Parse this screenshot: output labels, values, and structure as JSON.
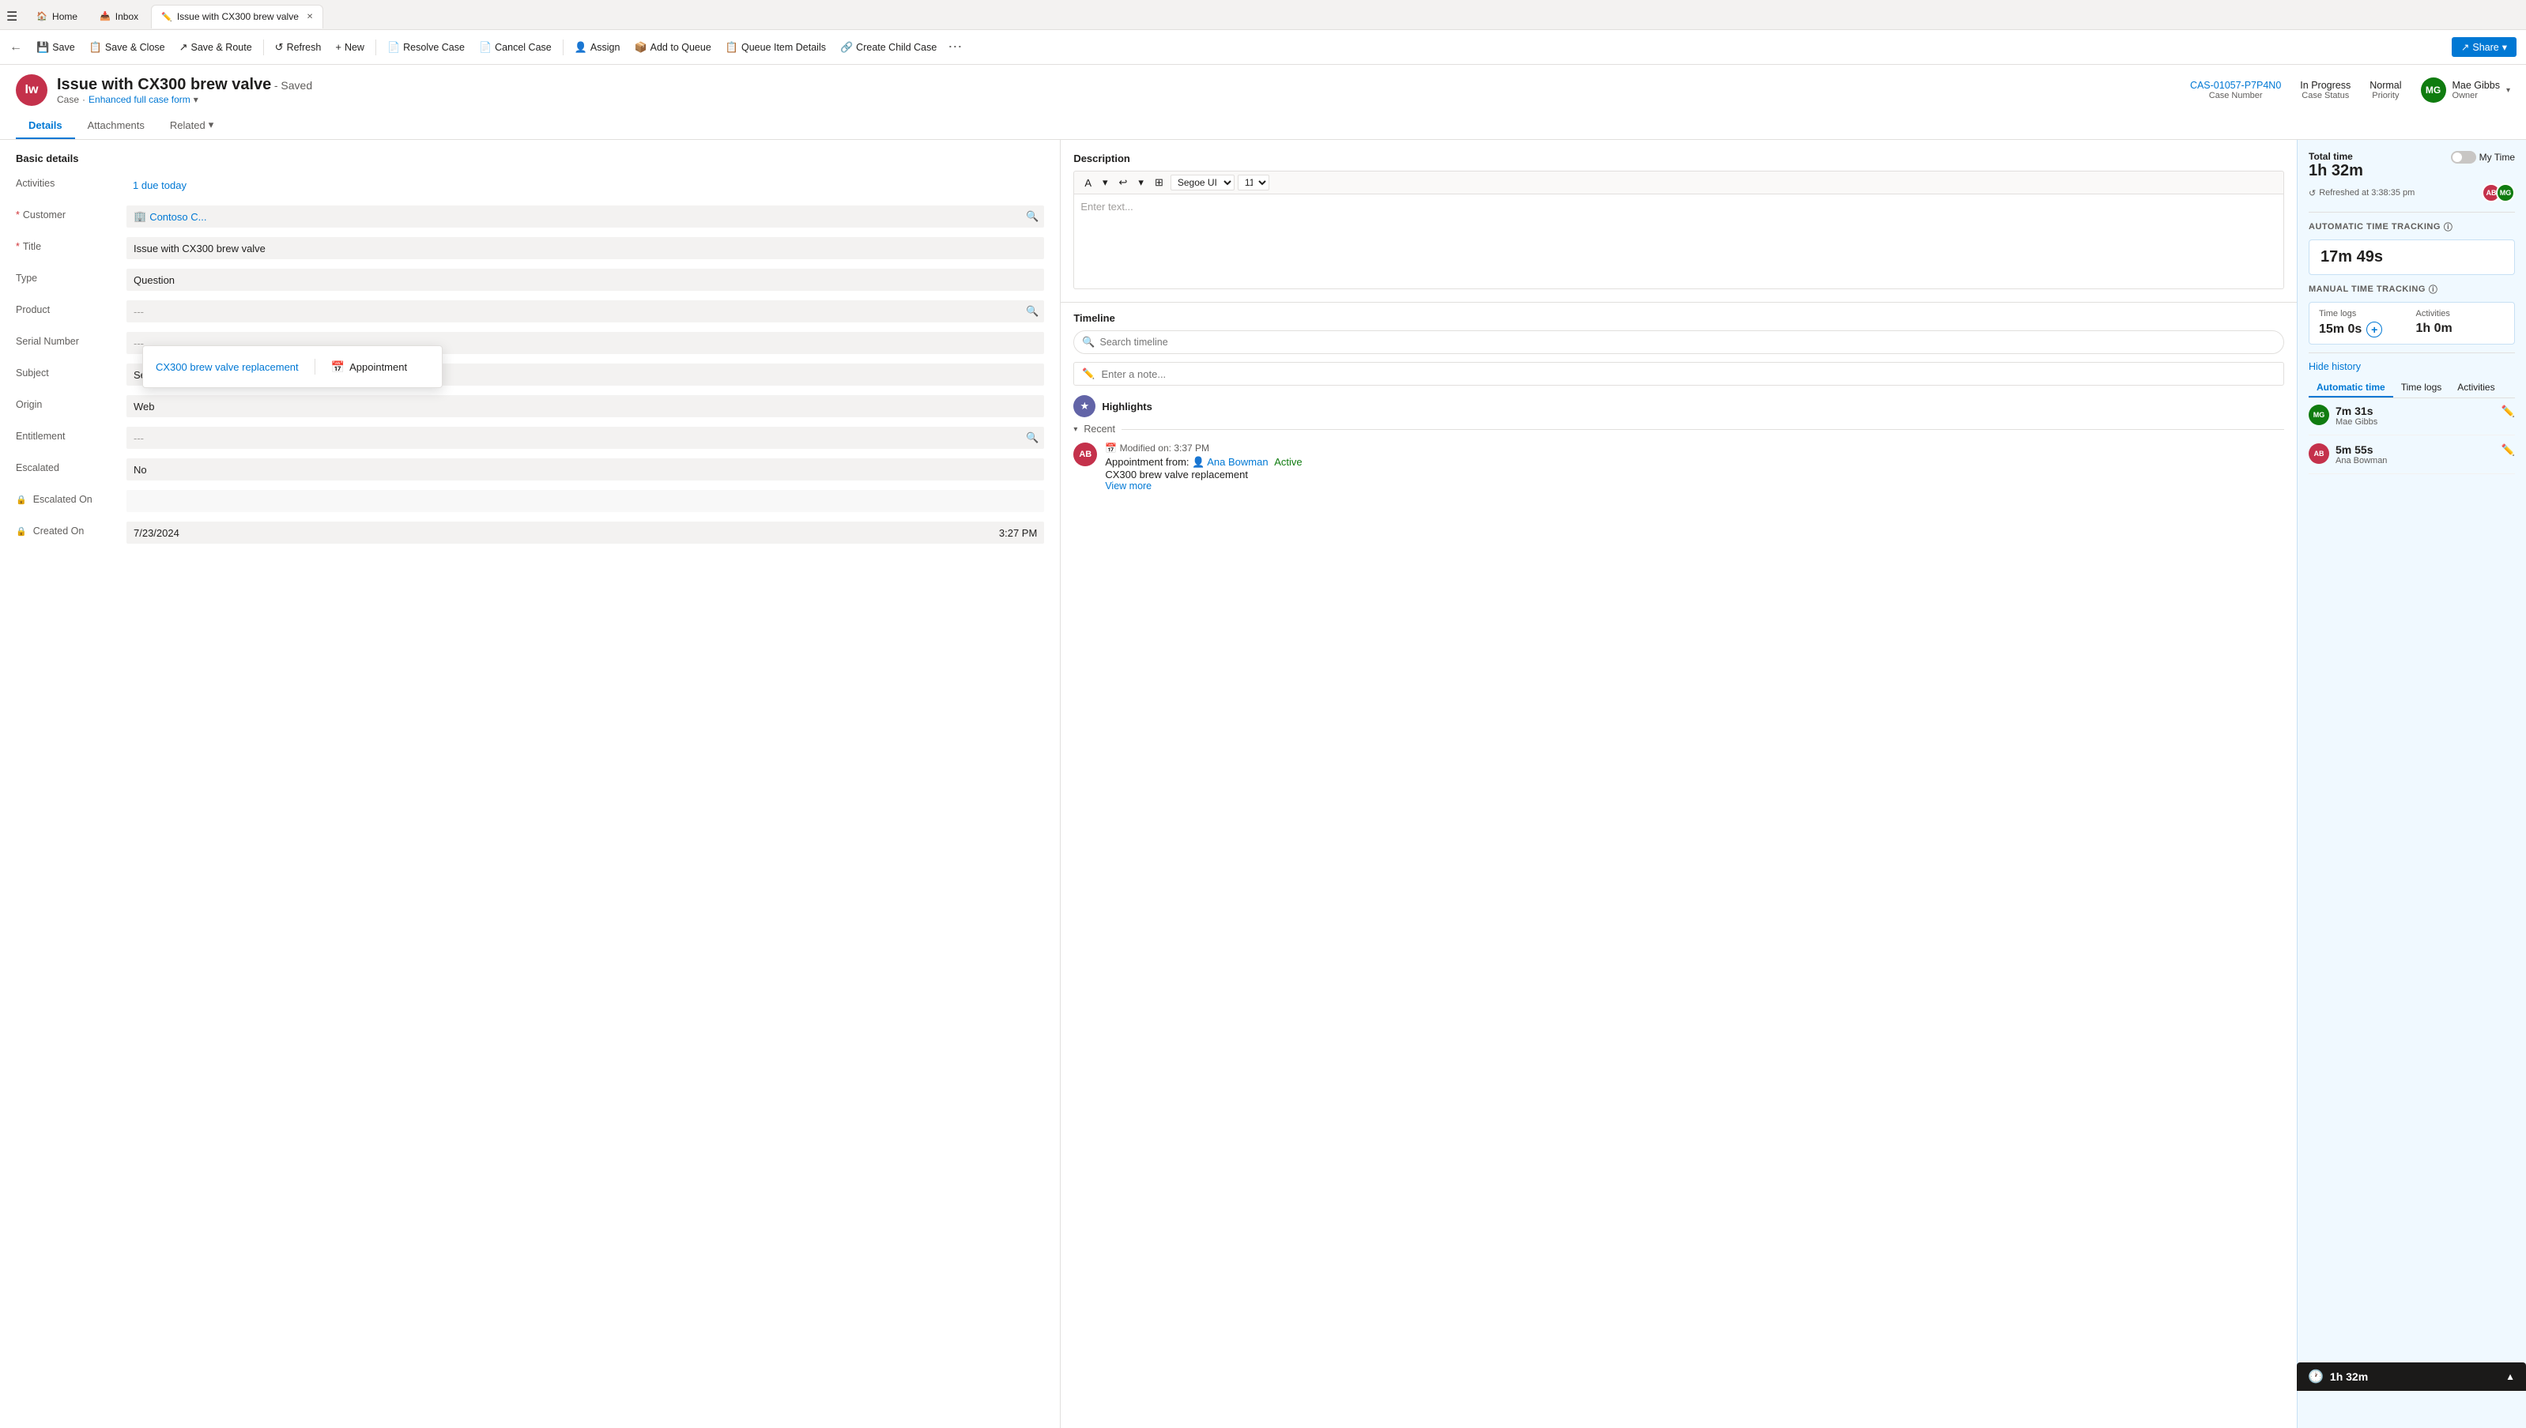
{
  "browser": {
    "tabs": [
      {
        "id": "home",
        "label": "Home",
        "icon": "🏠",
        "active": false
      },
      {
        "id": "inbox",
        "label": "Inbox",
        "icon": "📥",
        "active": false
      },
      {
        "id": "issue",
        "label": "Issue with CX300 brew valve",
        "icon": "✏️",
        "active": true,
        "closable": true
      }
    ]
  },
  "commandBar": {
    "back_icon": "←",
    "buttons": [
      {
        "id": "save",
        "label": "Save",
        "icon": "💾"
      },
      {
        "id": "save-close",
        "label": "Save & Close",
        "icon": "📋"
      },
      {
        "id": "save-route",
        "label": "Save & Route",
        "icon": "↗"
      },
      {
        "id": "refresh",
        "label": "Refresh",
        "icon": "↺"
      },
      {
        "id": "new",
        "label": "New",
        "icon": "+"
      },
      {
        "id": "resolve",
        "label": "Resolve Case",
        "icon": "📄"
      },
      {
        "id": "cancel",
        "label": "Cancel Case",
        "icon": "📄"
      },
      {
        "id": "assign",
        "label": "Assign",
        "icon": "👤"
      },
      {
        "id": "add-queue",
        "label": "Add to Queue",
        "icon": "📦"
      },
      {
        "id": "queue-details",
        "label": "Queue Item Details",
        "icon": "📋"
      },
      {
        "id": "child-case",
        "label": "Create Child Case",
        "icon": "🔗"
      }
    ],
    "share_label": "Share",
    "more_icon": "⋯"
  },
  "record": {
    "avatar_initials": "Iw",
    "avatar_bg": "#c4314b",
    "title": "Issue with CX300 brew valve",
    "saved_label": "- Saved",
    "subtitle_type": "Case",
    "subtitle_form": "Enhanced full case form",
    "case_number_label": "Case Number",
    "case_number_value": "CAS-01057-P7P4N0",
    "status_label": "Case Status",
    "status_value": "In Progress",
    "priority_label": "Priority",
    "priority_value": "Normal",
    "owner_label": "Owner",
    "owner_name": "Mae Gibbs",
    "owner_initials": "MG",
    "owner_avatar_bg": "#107c10"
  },
  "navTabs": [
    {
      "id": "details",
      "label": "Details",
      "active": true
    },
    {
      "id": "attachments",
      "label": "Attachments",
      "active": false
    },
    {
      "id": "related",
      "label": "Related",
      "active": false,
      "has_chevron": true
    }
  ],
  "basicDetails": {
    "section_title": "Basic details",
    "fields": [
      {
        "id": "activities",
        "label": "Activities",
        "value": "1 due today",
        "is_link": true,
        "required": false,
        "has_lock": false
      },
      {
        "id": "customer",
        "label": "Customer",
        "value": "Contoso C...",
        "is_link": true,
        "required": true,
        "has_search": true,
        "has_lock": false
      },
      {
        "id": "title",
        "label": "Title",
        "value": "Issue with CX300 brew valve",
        "required": true,
        "has_lock": false
      },
      {
        "id": "type",
        "label": "Type",
        "value": "Question",
        "required": false,
        "has_lock": false
      },
      {
        "id": "product",
        "label": "Product",
        "value": "---",
        "required": false,
        "has_search": true,
        "has_lock": false
      },
      {
        "id": "serial_number",
        "label": "Serial Number",
        "value": "---",
        "required": false,
        "has_lock": false
      },
      {
        "id": "subject",
        "label": "Subject",
        "value": "Service",
        "required": false,
        "has_lock": false
      },
      {
        "id": "origin",
        "label": "Origin",
        "value": "Web",
        "required": false,
        "has_lock": false
      },
      {
        "id": "entitlement",
        "label": "Entitlement",
        "value": "---",
        "required": false,
        "has_search": true,
        "has_lock": false
      },
      {
        "id": "escalated",
        "label": "Escalated",
        "value": "No",
        "required": false,
        "has_lock": false
      },
      {
        "id": "escalated_on",
        "label": "Escalated On",
        "value": "",
        "required": false,
        "has_lock": true
      },
      {
        "id": "created_on",
        "label": "Created On",
        "value": "7/23/2024",
        "time_value": "3:27 PM",
        "required": false,
        "has_lock": true
      }
    ]
  },
  "dropdown": {
    "link_text": "CX300 brew valve replacement",
    "appointment_label": "Appointment",
    "appointment_icon": "📅"
  },
  "description": {
    "title": "Description",
    "placeholder": "Enter text...",
    "toolbar": {
      "font_name": "Segoe UI",
      "font_size": "11"
    }
  },
  "timeline": {
    "title": "Timeline",
    "search_placeholder": "Search timeline",
    "note_placeholder": "Enter a note...",
    "highlights_label": "Highlights",
    "recent_label": "Recent",
    "entries": [
      {
        "id": "entry1",
        "avatar_initials": "AB",
        "avatar_bg": "#c4314b",
        "date": "Modified on: 3:37 PM",
        "type": "Appointment",
        "from_label": "Appointment from:",
        "from_person": "Ana Bowman",
        "status": "Active",
        "title": "CX300 brew valve replacement",
        "view_more": "View more"
      }
    ]
  },
  "timeTracking": {
    "total_time_label": "Total time",
    "total_time_value": "1h 32m",
    "my_time_label": "My Time",
    "refresh_label": "Refreshed at 3:38:35 pm",
    "auto_tracking_title": "AUTOMATIC TIME TRACKING",
    "auto_time_value": "17m 49s",
    "manual_tracking_title": "MANUAL TIME TRACKING",
    "time_logs_label": "Time logs",
    "time_logs_value": "15m 0s",
    "activities_label": "Activities",
    "activities_value": "1h 0m",
    "hide_history_label": "Hide history",
    "history_tabs": [
      {
        "id": "auto",
        "label": "Automatic time",
        "active": true
      },
      {
        "id": "logs",
        "label": "Time logs",
        "active": false
      },
      {
        "id": "activities",
        "label": "Activities",
        "active": false
      }
    ],
    "history_entries": [
      {
        "initials": "MG",
        "bg": "#107c10",
        "time": "7m 31s",
        "name": "Mae Gibbs"
      },
      {
        "initials": "AB",
        "bg": "#c4314b",
        "time": "5m 55s",
        "name": "Ana Bowman"
      }
    ],
    "bottom_bar_time": "1h 32m",
    "ab_avatar_bg": "#c4314b",
    "mg_avatar_bg": "#107c10"
  }
}
